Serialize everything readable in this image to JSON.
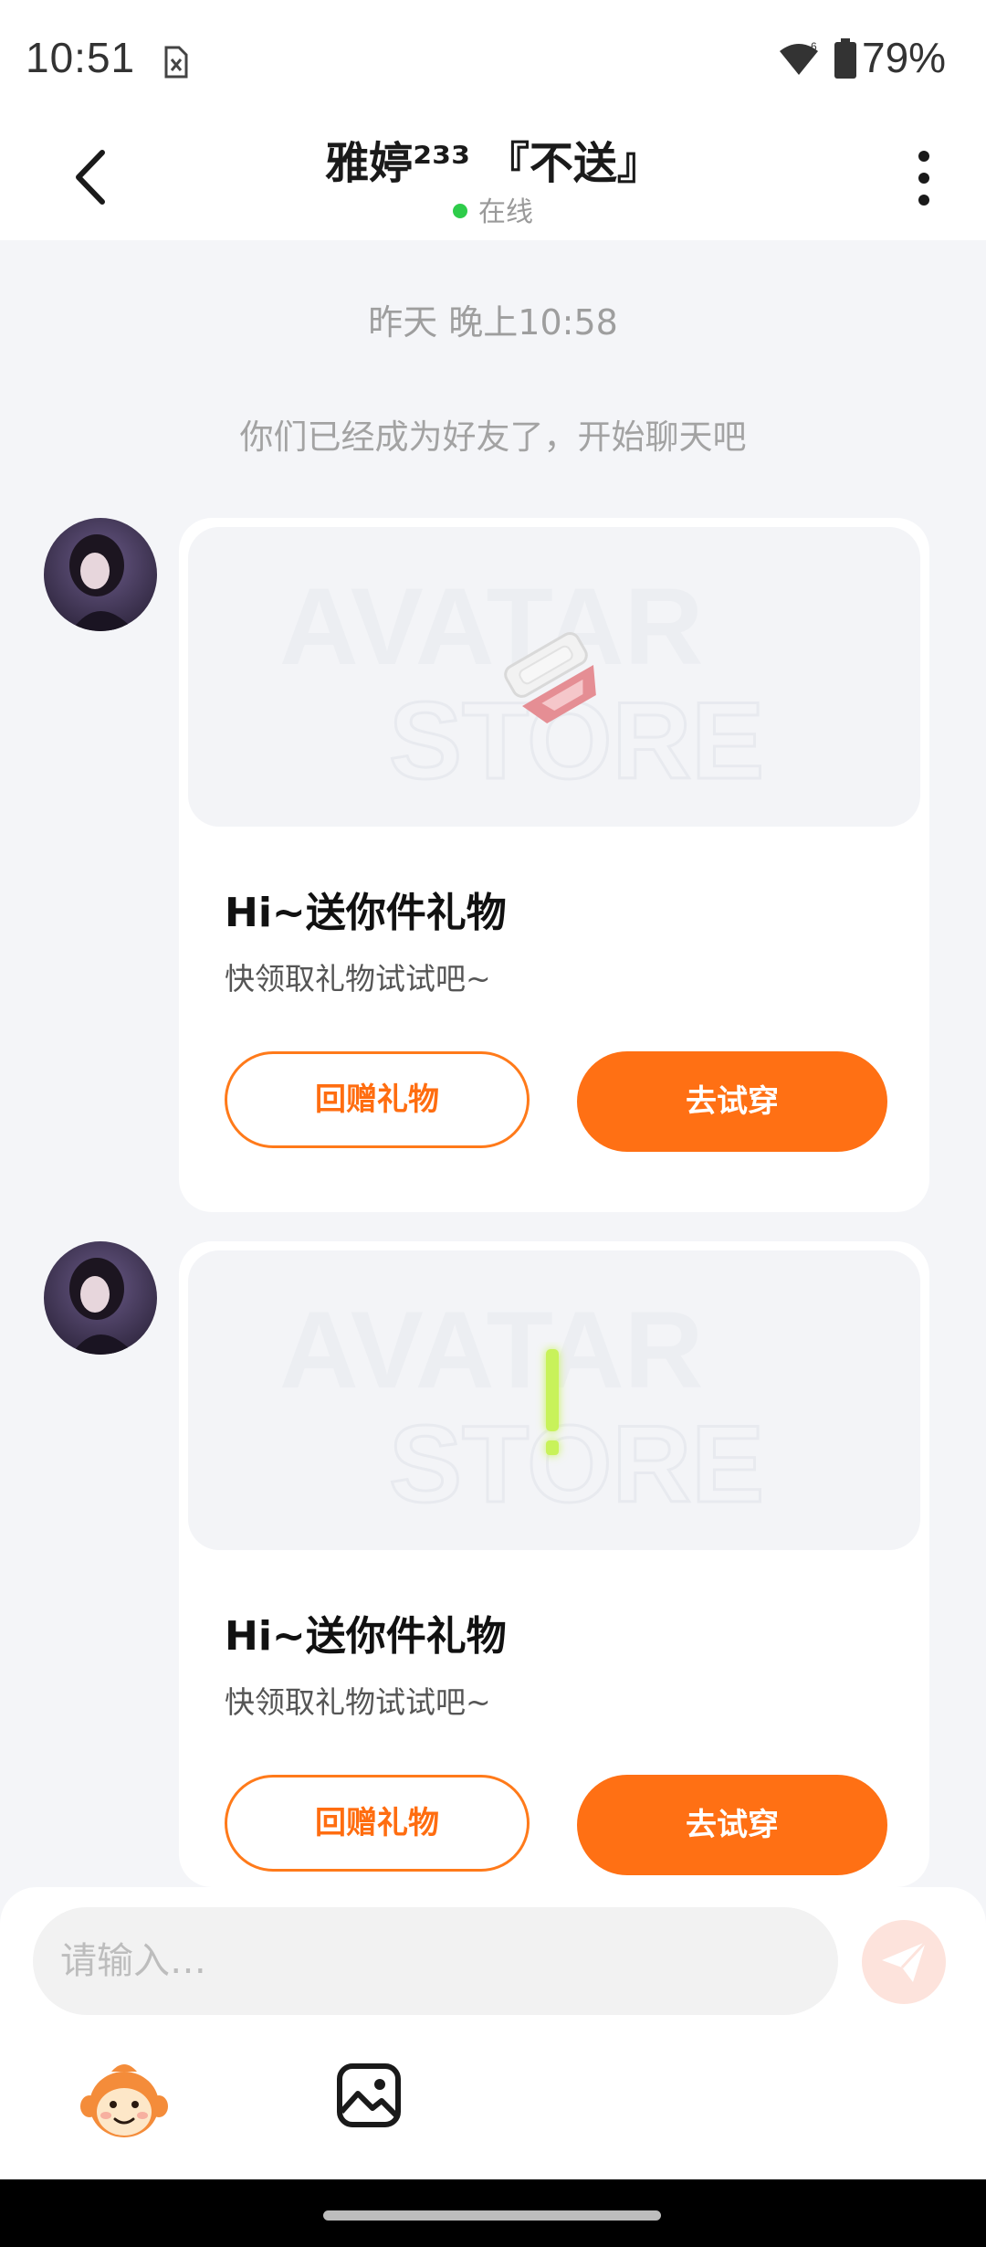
{
  "status_bar": {
    "time": "10:51",
    "battery": "79%"
  },
  "header": {
    "contact_name": "雅婷²³³ 『不送』",
    "online_status": "在线"
  },
  "chat": {
    "timestamp": "昨天 晚上10:58",
    "system_notice": "你们已经成为好友了，开始聊天吧",
    "messages": [
      {
        "title": "Hi~送你件礼物",
        "subtitle": "快领取礼物试试吧~",
        "return_gift_label": "回赠礼物",
        "try_on_label": "去试穿",
        "gift_icon": "hair-clip-icon"
      },
      {
        "title": "Hi~送你件礼物",
        "subtitle": "快领取礼物试试吧~",
        "return_gift_label": "回赠礼物",
        "try_on_label": "去试穿",
        "gift_icon": "neon-exclamation-icon"
      }
    ]
  },
  "input": {
    "placeholder": "请输入…"
  },
  "colors": {
    "accent": "#ff7014",
    "online": "#2ecc4a",
    "background": "#f4f5f8",
    "send_disabled": "#fde3dc"
  }
}
